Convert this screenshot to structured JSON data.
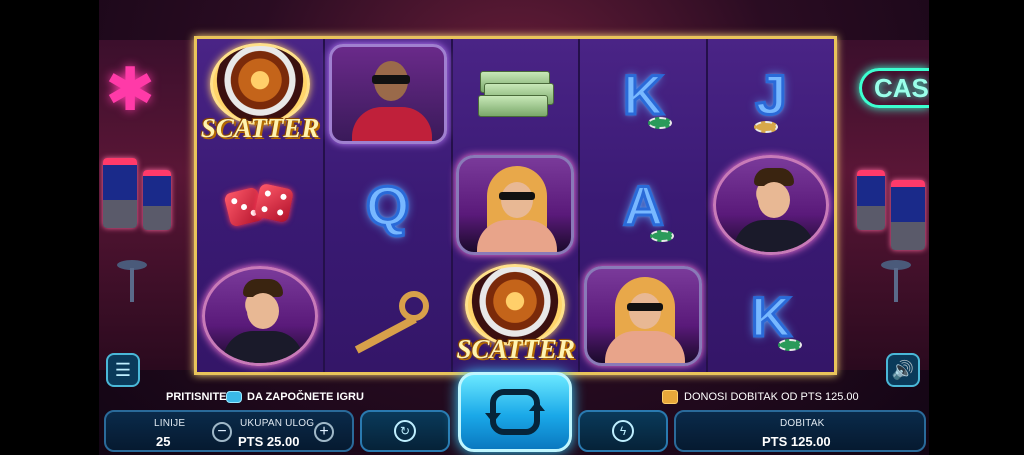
{
  "game": {
    "reels": [
      [
        "scatter",
        "dice",
        "card-man"
      ],
      [
        "cigar-man",
        "Q",
        "key"
      ],
      [
        "money",
        "blonde-woman",
        "scatter"
      ],
      [
        "K",
        "A",
        "blonde-woman"
      ],
      [
        "J",
        "card-man",
        "K"
      ]
    ],
    "scatter_text": "SCATTER",
    "cards": {
      "q": "Q",
      "k": "K",
      "a": "A",
      "j": "J"
    }
  },
  "neon": {
    "right_sign": "CAS"
  },
  "hud": {
    "prompt_before": "PRITISNITE",
    "prompt_after": "DA ZAPOČNETE IGRU",
    "win_message": "DONOSI DOBITAK OD PTS 125.00",
    "lines_label": "LINIJE",
    "lines_value": "25",
    "bet_label": "UKUPAN ULOG",
    "bet_value": "PTS 25.00",
    "win_label": "DOBITAK",
    "win_value": "PTS 125.00",
    "minus": "−",
    "plus": "+"
  },
  "icons": {
    "menu": "menu-icon",
    "sound": "speaker-icon",
    "spin": "spin-icon",
    "autoplay": "autoplay-icon",
    "turbo": "lightning-icon",
    "coin": "coin-icon"
  },
  "colors": {
    "frame": "#e9c45a",
    "spin": "#1aa8e8",
    "hud_border": "#2a6a9a"
  }
}
